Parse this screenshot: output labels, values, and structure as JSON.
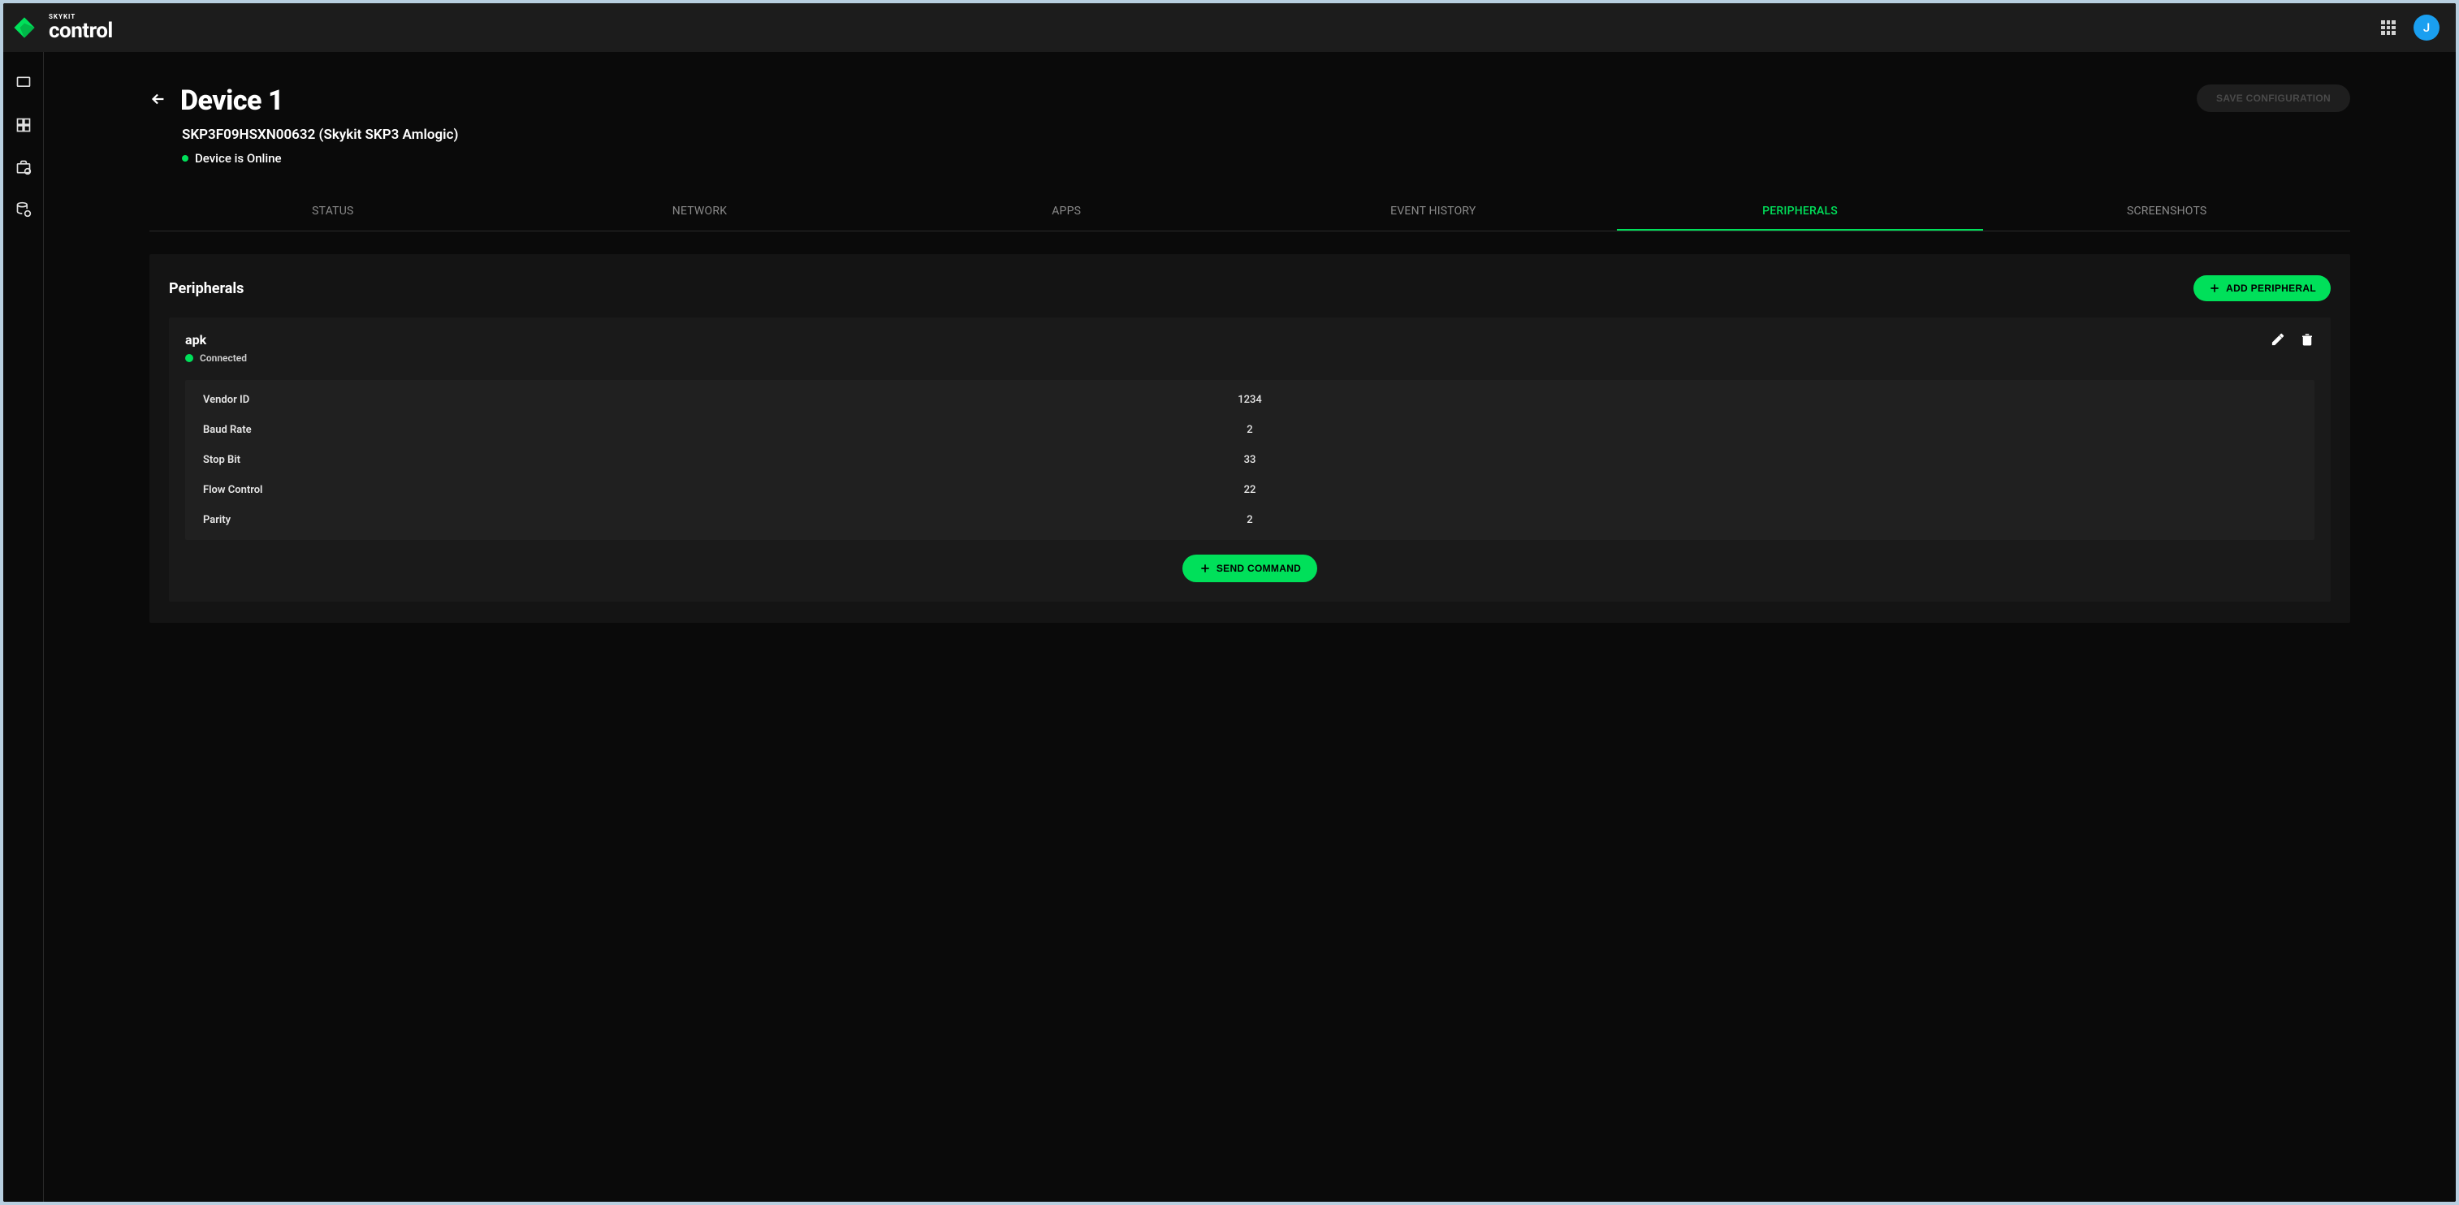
{
  "header": {
    "brand": "SKYKIT",
    "product": "control",
    "avatar_initial": "J"
  },
  "page": {
    "title": "Device 1",
    "subtitle": "SKP3F09HSXN00632 (Skykit SKP3 Amlogic)",
    "status_label": "Device is Online",
    "save_label": "SAVE CONFIGURATION"
  },
  "tabs": [
    {
      "label": "STATUS"
    },
    {
      "label": "NETWORK"
    },
    {
      "label": "APPS"
    },
    {
      "label": "EVENT HISTORY"
    },
    {
      "label": "PERIPHERALS"
    },
    {
      "label": "SCREENSHOTS"
    }
  ],
  "active_tab_index": 4,
  "panel": {
    "title": "Peripherals",
    "add_label": "ADD PERIPHERAL"
  },
  "peripheral": {
    "name": "apk",
    "status": "Connected",
    "send_label": "SEND COMMAND",
    "rows": [
      {
        "key": "Vendor ID",
        "value": "1234"
      },
      {
        "key": "Baud Rate",
        "value": "2"
      },
      {
        "key": "Stop Bit",
        "value": "33"
      },
      {
        "key": "Flow Control",
        "value": "22"
      },
      {
        "key": "Parity",
        "value": "2"
      }
    ]
  }
}
